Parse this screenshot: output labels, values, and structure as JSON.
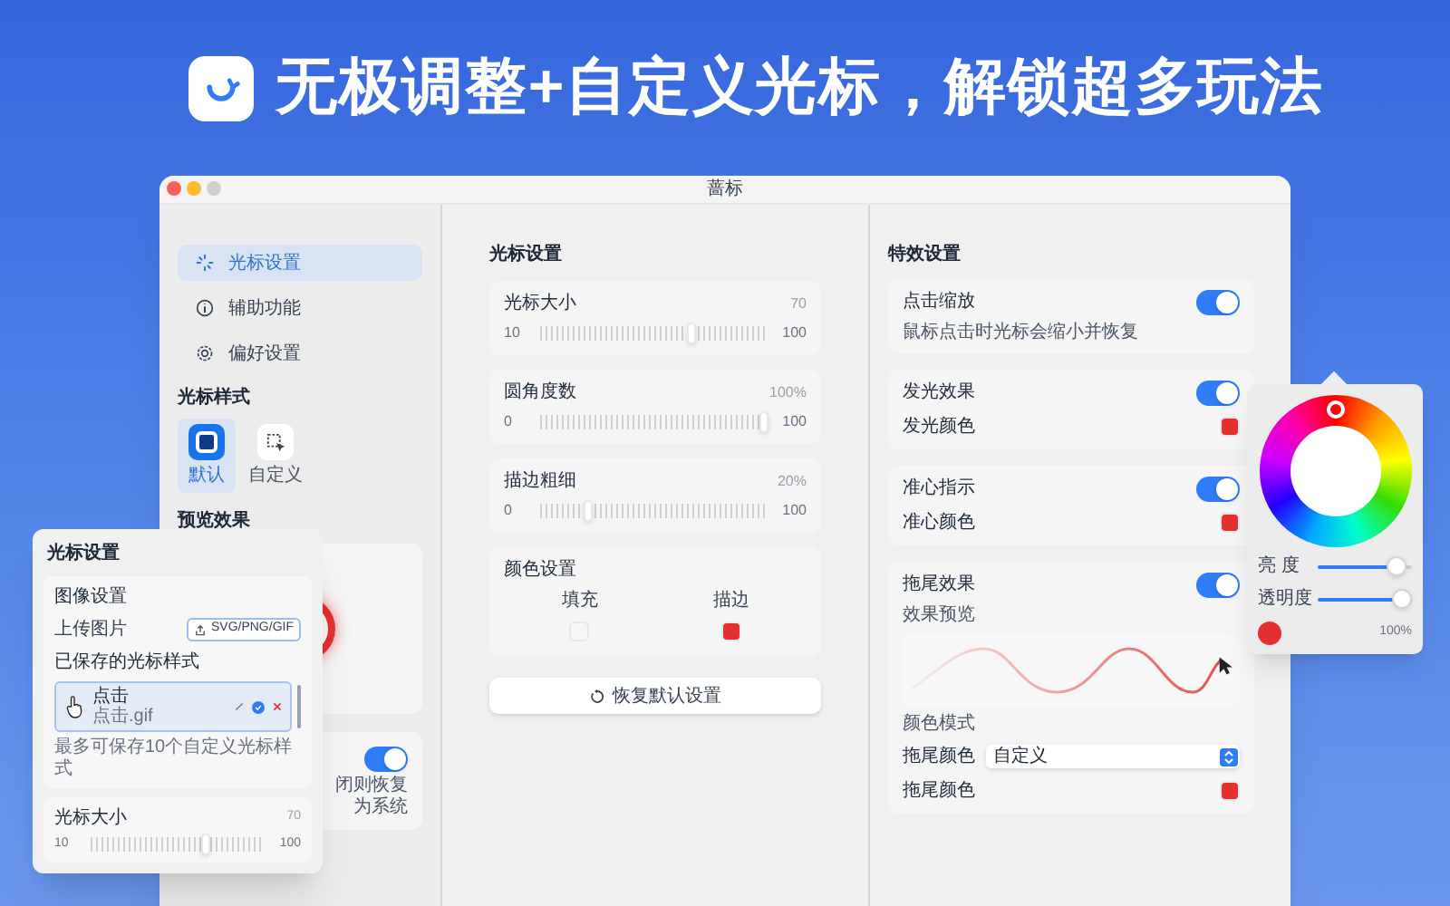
{
  "headline": "无极调整+自定义光标，解锁超多玩法",
  "window": {
    "title": "蔷标"
  },
  "sidebar": {
    "items": [
      {
        "label": "光标设置",
        "selected": true
      },
      {
        "label": "辅助功能",
        "selected": false
      },
      {
        "label": "偏好设置",
        "selected": false
      }
    ],
    "style_heading": "光标样式",
    "styles": [
      {
        "label": "默认",
        "selected": true
      },
      {
        "label": "自定义",
        "selected": false
      }
    ],
    "preview_heading": "预览效果",
    "toggle_card": {
      "on": true,
      "text": "闭则恢复为系统"
    }
  },
  "cursor_settings": {
    "heading": "光标设置",
    "sliders": [
      {
        "label": "光标大小",
        "reading": "70",
        "min": "10",
        "max": "100",
        "level": 0.67
      },
      {
        "label": "圆角度数",
        "reading": "100%",
        "min": "0",
        "max": "100",
        "level": 1
      },
      {
        "label": "描边粗细",
        "reading": "20%",
        "min": "0",
        "max": "100",
        "level": 0.2
      }
    ],
    "colors": {
      "heading": "颜色设置",
      "items": [
        {
          "label": "填充",
          "color": "#f6f6f6"
        },
        {
          "label": "描边",
          "color": "#e53030"
        }
      ]
    },
    "reset_button": "恢复默认设置"
  },
  "effects": {
    "heading": "特效设置",
    "cards": [
      [
        {
          "kind": "toggle",
          "label": "点击缩放",
          "on": true
        },
        {
          "kind": "note",
          "text": "鼠标点击时光标会缩小并恢复"
        }
      ],
      [
        {
          "kind": "toggle",
          "label": "发光效果",
          "on": true
        },
        {
          "kind": "swatch",
          "label": "发光颜色",
          "color": "#e53030"
        }
      ],
      [
        {
          "kind": "toggle",
          "label": "准心指示",
          "on": true
        },
        {
          "kind": "swatch",
          "label": "准心颜色",
          "color": "#e53030"
        }
      ],
      [
        {
          "kind": "toggle",
          "label": "拖尾效果",
          "on": true
        },
        {
          "kind": "note",
          "text": "效果预览"
        },
        {
          "kind": "preview"
        },
        {
          "kind": "note",
          "text": "颜色模式"
        },
        {
          "kind": "select",
          "label": "拖尾颜色",
          "value": "自定义"
        },
        {
          "kind": "swatch",
          "label": "拖尾颜色",
          "color": "#e53030"
        }
      ]
    ]
  },
  "color_picker": {
    "sliders": [
      {
        "label": "亮 度",
        "level": 0.93
      },
      {
        "label": "透明度",
        "level": 1
      }
    ],
    "color": "#e53030",
    "reading": "100%"
  },
  "overlay": {
    "title": "光标设置",
    "image_heading": "图像设置",
    "upload_label": "上传图片",
    "upload_button": "SVG/PNG/GIF",
    "saved_heading": "已保存的光标样式",
    "saved": [
      {
        "name": "点击",
        "file": "点击.gif",
        "selected": true
      }
    ],
    "note": "最多可保存10个自定义光标样式",
    "slider": {
      "label": "光标大小",
      "reading": "70",
      "min": "10",
      "max": "100",
      "level": 0.67
    }
  }
}
